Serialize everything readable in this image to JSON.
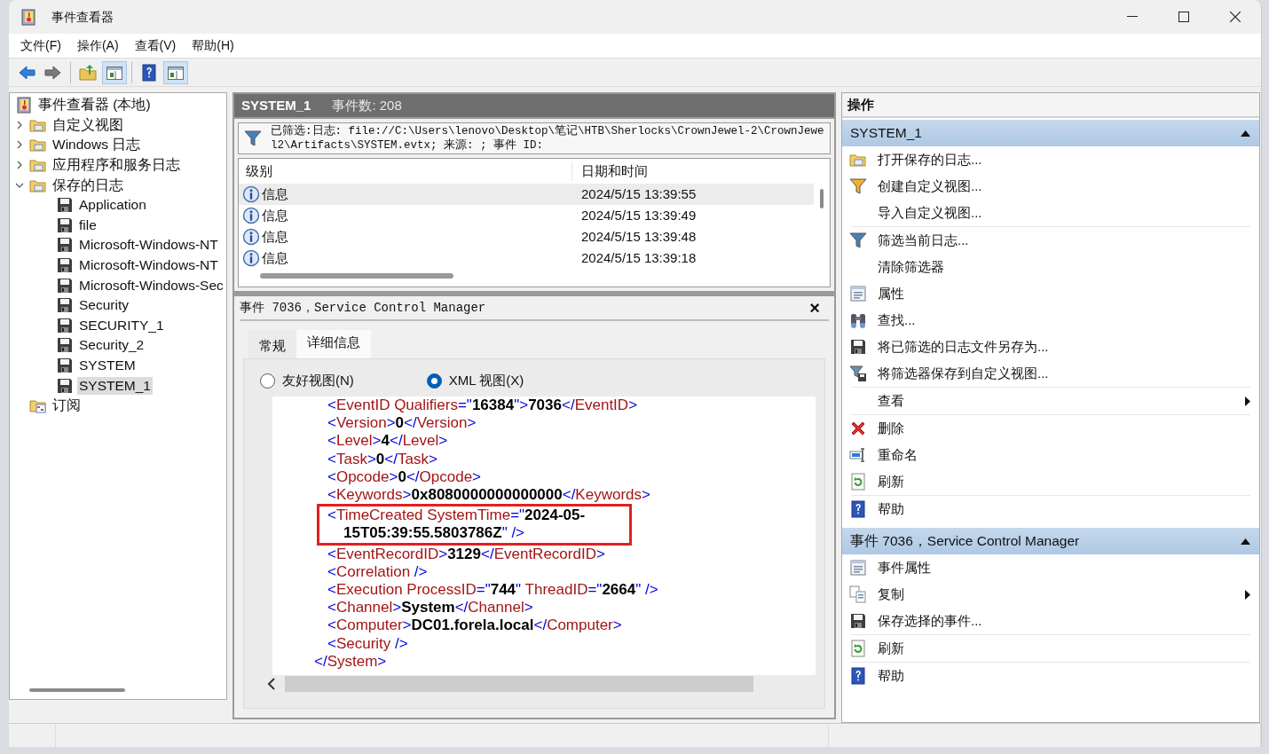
{
  "window": {
    "title": "事件查看器"
  },
  "menu": [
    "文件(F)",
    "操作(A)",
    "查看(V)",
    "帮助(H)"
  ],
  "toolbar": [
    {
      "kind": "back",
      "pressed": false
    },
    {
      "kind": "forward",
      "pressed": false
    },
    {
      "kind": "up",
      "pressed": false
    },
    {
      "kind": "tree-pane",
      "pressed": true
    },
    {
      "kind": "help",
      "pressed": false
    },
    {
      "kind": "action-pane",
      "pressed": true
    }
  ],
  "tree": {
    "label": "事件查看器 (本地)",
    "selected": false,
    "children": [
      {
        "label": "自定义视图",
        "kind": "folder",
        "expanded": false,
        "selected": false
      },
      {
        "label": "Windows 日志",
        "kind": "folder",
        "expanded": false,
        "selected": false
      },
      {
        "label": "应用程序和服务日志",
        "kind": "folder",
        "expanded": false,
        "selected": false
      },
      {
        "label": "保存的日志",
        "kind": "folder",
        "expanded": true,
        "selected": false,
        "children": [
          {
            "label": "Application",
            "kind": "log",
            "selected": false
          },
          {
            "label": "file",
            "kind": "log",
            "selected": false
          },
          {
            "label": "Microsoft-Windows-NT",
            "kind": "log",
            "selected": false
          },
          {
            "label": "Microsoft-Windows-NT",
            "kind": "log",
            "selected": false
          },
          {
            "label": "Microsoft-Windows-Sec",
            "kind": "log",
            "selected": false
          },
          {
            "label": "Security",
            "kind": "log",
            "selected": false
          },
          {
            "label": "SECURITY_1",
            "kind": "log",
            "selected": false
          },
          {
            "label": "Security_2",
            "kind": "log",
            "selected": false
          },
          {
            "label": "SYSTEM",
            "kind": "log",
            "selected": false
          },
          {
            "label": "SYSTEM_1",
            "kind": "log",
            "selected": true
          }
        ]
      },
      {
        "label": "订阅",
        "kind": "subscription",
        "selected": false
      }
    ]
  },
  "log_header": {
    "name": "SYSTEM_1",
    "count": "事件数: 208"
  },
  "filter": "已筛选:日志: file://C:\\Users\\lenovo\\Desktop\\笔记\\HTB\\Sherlocks\\CrownJewel-2\\CrownJewel2\\Artifacts\\SYSTEM.evtx; 来源: ; 事件 ID:",
  "events": {
    "columns": [
      "级别",
      "日期和时间"
    ],
    "rows": [
      {
        "level": "信息",
        "datetime": "2024/5/15 13:39:55",
        "selected": true
      },
      {
        "level": "信息",
        "datetime": "2024/5/15 13:39:49",
        "selected": false
      },
      {
        "level": "信息",
        "datetime": "2024/5/15 13:39:48",
        "selected": false
      },
      {
        "level": "信息",
        "datetime": "2024/5/15 13:39:18",
        "selected": false
      }
    ]
  },
  "detail": {
    "title": "事件 7036，Service Control Manager",
    "close": "×",
    "tabs": [
      {
        "label": "常规",
        "selected": false
      },
      {
        "label": "详细信息",
        "selected": true
      }
    ],
    "views": [
      {
        "label": "友好视图(N)",
        "selected": false
      },
      {
        "label": "XML 视图(X)",
        "selected": true
      }
    ],
    "xml": [
      {
        "kind": "child",
        "boxed": false,
        "tokens": [
          {
            "kind": "punct",
            "text": "<"
          },
          {
            "kind": "name",
            "text": "EventID Qualifiers"
          },
          {
            "kind": "punct",
            "text": "=\""
          },
          {
            "kind": "value",
            "text": "16384"
          },
          {
            "kind": "punct",
            "text": "\">"
          },
          {
            "kind": "value",
            "text": "7036"
          },
          {
            "kind": "punct",
            "text": "</"
          },
          {
            "kind": "name",
            "text": "EventID"
          },
          {
            "kind": "punct",
            "text": ">"
          }
        ]
      },
      {
        "kind": "child",
        "boxed": false,
        "tokens": [
          {
            "kind": "punct",
            "text": "<"
          },
          {
            "kind": "name",
            "text": "Version"
          },
          {
            "kind": "punct",
            "text": ">"
          },
          {
            "kind": "value",
            "text": "0"
          },
          {
            "kind": "punct",
            "text": "</"
          },
          {
            "kind": "name",
            "text": "Version"
          },
          {
            "kind": "punct",
            "text": ">"
          }
        ]
      },
      {
        "kind": "child",
        "boxed": false,
        "tokens": [
          {
            "kind": "punct",
            "text": "<"
          },
          {
            "kind": "name",
            "text": "Level"
          },
          {
            "kind": "punct",
            "text": ">"
          },
          {
            "kind": "value",
            "text": "4"
          },
          {
            "kind": "punct",
            "text": "</"
          },
          {
            "kind": "name",
            "text": "Level"
          },
          {
            "kind": "punct",
            "text": ">"
          }
        ]
      },
      {
        "kind": "child",
        "boxed": false,
        "tokens": [
          {
            "kind": "punct",
            "text": "<"
          },
          {
            "kind": "name",
            "text": "Task"
          },
          {
            "kind": "punct",
            "text": ">"
          },
          {
            "kind": "value",
            "text": "0"
          },
          {
            "kind": "punct",
            "text": "</"
          },
          {
            "kind": "name",
            "text": "Task"
          },
          {
            "kind": "punct",
            "text": ">"
          }
        ]
      },
      {
        "kind": "child",
        "boxed": false,
        "tokens": [
          {
            "kind": "punct",
            "text": "<"
          },
          {
            "kind": "name",
            "text": "Opcode"
          },
          {
            "kind": "punct",
            "text": ">"
          },
          {
            "kind": "value",
            "text": "0"
          },
          {
            "kind": "punct",
            "text": "</"
          },
          {
            "kind": "name",
            "text": "Opcode"
          },
          {
            "kind": "punct",
            "text": ">"
          }
        ]
      },
      {
        "kind": "child",
        "boxed": false,
        "tokens": [
          {
            "kind": "punct",
            "text": "<"
          },
          {
            "kind": "name",
            "text": "Keywords"
          },
          {
            "kind": "punct",
            "text": ">"
          },
          {
            "kind": "value",
            "text": "0x8080000000000000"
          },
          {
            "kind": "punct",
            "text": "</"
          },
          {
            "kind": "name",
            "text": "Keywords"
          },
          {
            "kind": "punct",
            "text": ">"
          }
        ]
      },
      {
        "kind": "child",
        "boxed": true,
        "tokens": [
          {
            "kind": "punct",
            "text": "<"
          },
          {
            "kind": "name",
            "text": "TimeCreated SystemTime"
          },
          {
            "kind": "punct",
            "text": "=\""
          },
          {
            "kind": "value",
            "text": "2024-05-"
          }
        ]
      },
      {
        "kind": "wrap",
        "boxed": true,
        "tokens": [
          {
            "kind": "value",
            "text": "15T05:39:55.5803786Z"
          },
          {
            "kind": "punct",
            "text": "\" />"
          }
        ]
      },
      {
        "kind": "child",
        "boxed": false,
        "tokens": [
          {
            "kind": "punct",
            "text": "<"
          },
          {
            "kind": "name",
            "text": "EventRecordID"
          },
          {
            "kind": "punct",
            "text": ">"
          },
          {
            "kind": "value",
            "text": "3129"
          },
          {
            "kind": "punct",
            "text": "</"
          },
          {
            "kind": "name",
            "text": "EventRecordID"
          },
          {
            "kind": "punct",
            "text": ">"
          }
        ]
      },
      {
        "kind": "child",
        "boxed": false,
        "tokens": [
          {
            "kind": "punct",
            "text": "<"
          },
          {
            "kind": "name",
            "text": "Correlation"
          },
          {
            "kind": "punct",
            "text": " />"
          }
        ]
      },
      {
        "kind": "child",
        "boxed": false,
        "tokens": [
          {
            "kind": "punct",
            "text": "<"
          },
          {
            "kind": "name",
            "text": "Execution ProcessID"
          },
          {
            "kind": "punct",
            "text": "=\""
          },
          {
            "kind": "value",
            "text": "744"
          },
          {
            "kind": "punct",
            "text": "\""
          },
          {
            "kind": "name",
            "text": " ThreadID"
          },
          {
            "kind": "punct",
            "text": "=\""
          },
          {
            "kind": "value",
            "text": "2664"
          },
          {
            "kind": "punct",
            "text": "\" />"
          }
        ]
      },
      {
        "kind": "child",
        "boxed": false,
        "tokens": [
          {
            "kind": "punct",
            "text": "<"
          },
          {
            "kind": "name",
            "text": "Channel"
          },
          {
            "kind": "punct",
            "text": ">"
          },
          {
            "kind": "value",
            "text": "System"
          },
          {
            "kind": "punct",
            "text": "</"
          },
          {
            "kind": "name",
            "text": "Channel"
          },
          {
            "kind": "punct",
            "text": ">"
          }
        ]
      },
      {
        "kind": "child",
        "boxed": false,
        "tokens": [
          {
            "kind": "punct",
            "text": "<"
          },
          {
            "kind": "name",
            "text": "Computer"
          },
          {
            "kind": "punct",
            "text": ">"
          },
          {
            "kind": "value",
            "text": "DC01.forela.local"
          },
          {
            "kind": "punct",
            "text": "</"
          },
          {
            "kind": "name",
            "text": "Computer"
          },
          {
            "kind": "punct",
            "text": ">"
          }
        ]
      },
      {
        "kind": "child",
        "boxed": false,
        "tokens": [
          {
            "kind": "punct",
            "text": "<"
          },
          {
            "kind": "name",
            "text": "Security"
          },
          {
            "kind": "punct",
            "text": " />"
          }
        ]
      },
      {
        "kind": "close",
        "boxed": false,
        "tokens": [
          {
            "kind": "punct",
            "text": "</"
          },
          {
            "kind": "name",
            "text": "System"
          },
          {
            "kind": "punct",
            "text": ">"
          }
        ]
      }
    ]
  },
  "actions": {
    "title": "操作",
    "sections": [
      {
        "title": "SYSTEM_1",
        "expanded": true,
        "groups": [
          [
            {
              "label": "打开保存的日志...",
              "kind": "open-folder",
              "submenu": false
            },
            {
              "label": "创建自定义视图...",
              "kind": "funnel-star",
              "submenu": false
            },
            {
              "label": "导入自定义视图...",
              "submenu": false
            }
          ],
          [
            {
              "label": "筛选当前日志...",
              "kind": "funnel",
              "submenu": false
            },
            {
              "label": "清除筛选器",
              "submenu": false
            },
            {
              "label": "属性",
              "kind": "properties",
              "submenu": false
            },
            {
              "label": "查找...",
              "kind": "binoculars",
              "submenu": false
            },
            {
              "label": "将已筛选的日志文件另存为...",
              "kind": "floppy",
              "submenu": false
            },
            {
              "label": "将筛选器保存到自定义视图...",
              "kind": "funnel-save",
              "submenu": false
            }
          ],
          [
            {
              "label": "查看",
              "submenu": true
            }
          ],
          [
            {
              "label": "删除",
              "kind": "delete",
              "submenu": false
            },
            {
              "label": "重命名",
              "kind": "rename",
              "submenu": false
            },
            {
              "label": "刷新",
              "kind": "refresh",
              "submenu": false
            }
          ],
          [
            {
              "label": "帮助",
              "kind": "help",
              "submenu": false
            }
          ]
        ]
      },
      {
        "title": "事件 7036，Service Control Manager",
        "expanded": true,
        "groups": [
          [
            {
              "label": "事件属性",
              "kind": "properties",
              "submenu": false
            },
            {
              "label": "复制",
              "kind": "copy",
              "submenu": true
            },
            {
              "label": "保存选择的事件...",
              "kind": "floppy",
              "submenu": false
            }
          ],
          [
            {
              "label": "刷新",
              "kind": "refresh",
              "submenu": false
            }
          ],
          [
            {
              "label": "帮助",
              "kind": "help",
              "submenu": false
            }
          ]
        ]
      }
    ]
  }
}
